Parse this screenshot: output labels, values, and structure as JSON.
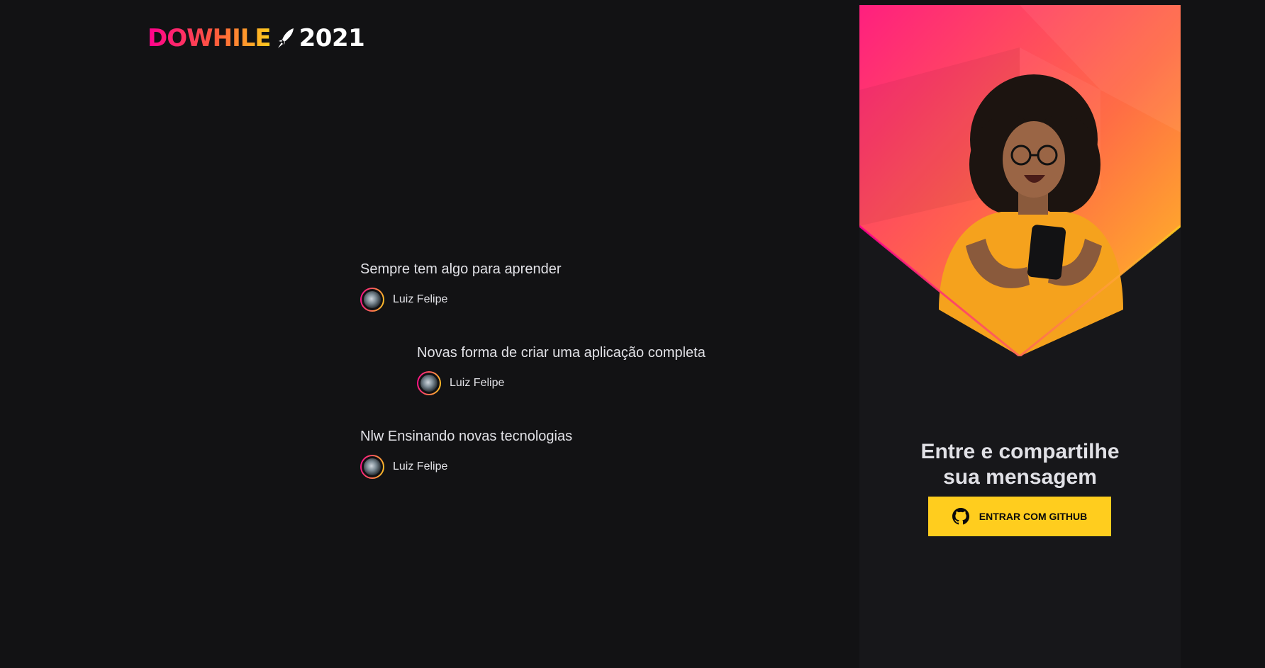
{
  "logo": {
    "brand": "DOWHILE",
    "year": "2021"
  },
  "messages": [
    {
      "content": "Sempre tem algo para aprender",
      "user": "Luiz Felipe"
    },
    {
      "content": "Novas forma de criar uma aplicação completa",
      "user": "Luiz Felipe"
    },
    {
      "content": "Nlw Ensinando novas tecnologias",
      "user": "Luiz Felipe"
    }
  ],
  "login_panel": {
    "title_line1": "Entre e compartilhe",
    "title_line2": "sua mensagem",
    "github_button_label": "ENTRAR COM GITHUB",
    "button_icon": "github-icon"
  },
  "colors": {
    "background": "#121214",
    "panel": "#17171a",
    "button": "#ffcd1e",
    "gradient_start": "#ff008e",
    "gradient_end": "#ffcd1e",
    "text": "#e1e1e6"
  }
}
